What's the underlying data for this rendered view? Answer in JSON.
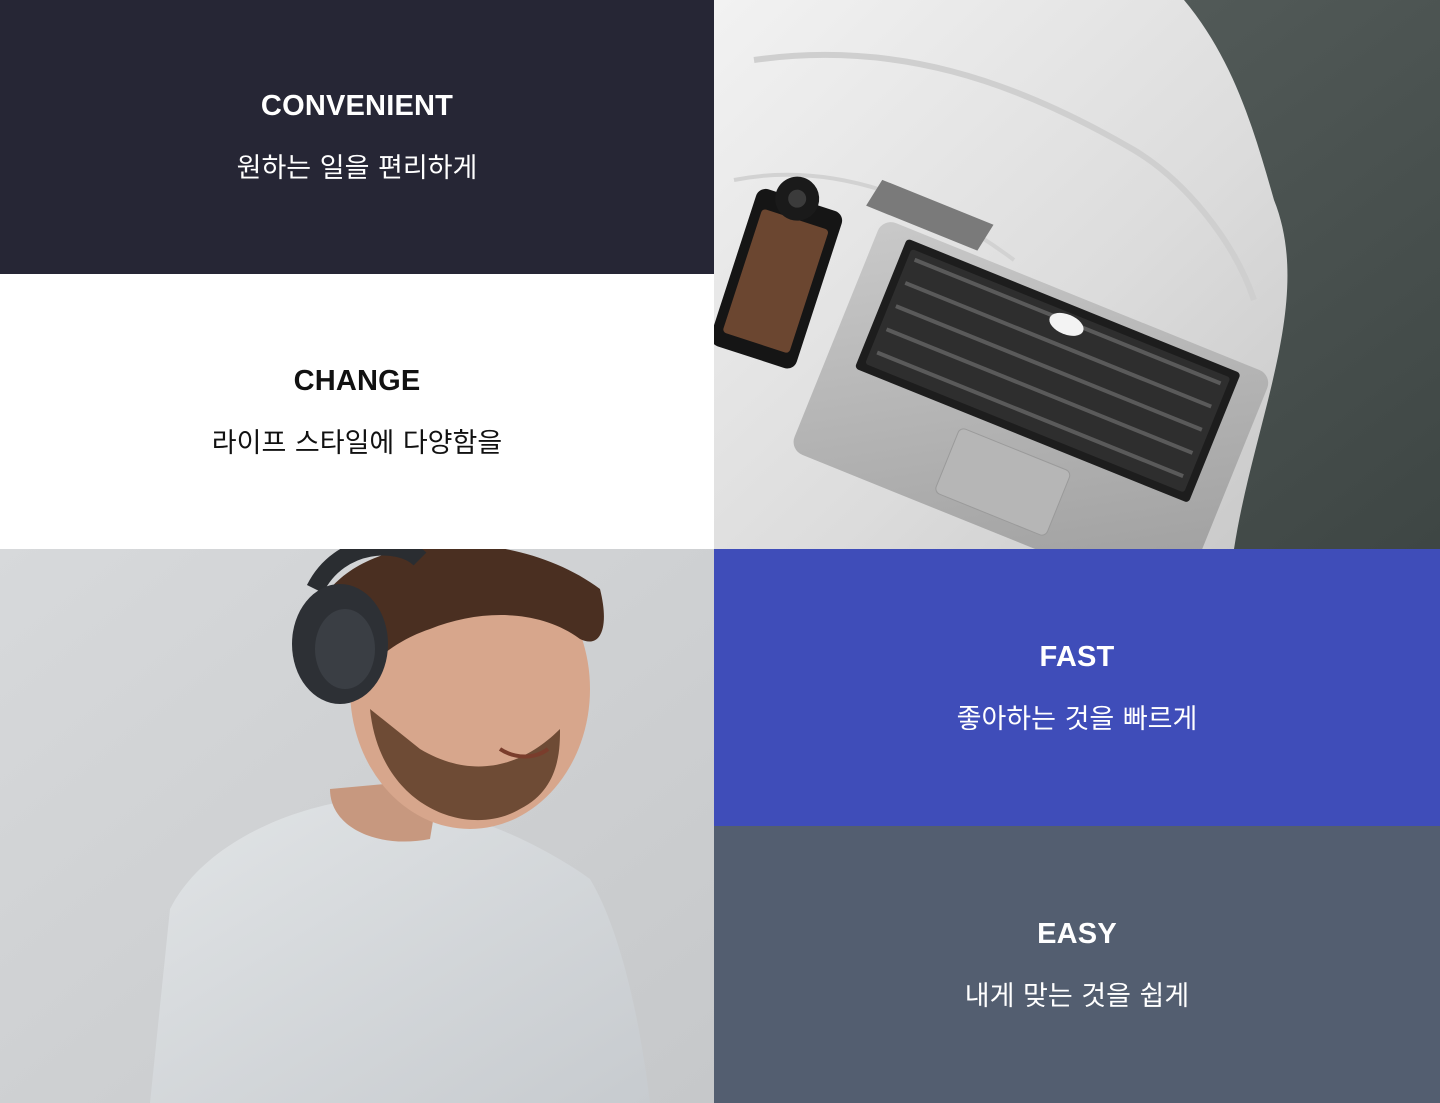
{
  "panels": {
    "convenient": {
      "title": "CONVENIENT",
      "subtitle": "원하는 일을 편리하게",
      "bg": "#262635",
      "fg": "#ffffff"
    },
    "change": {
      "title": "CHANGE",
      "subtitle": "라이프 스타일에 다양함을",
      "bg": "#ffffff",
      "fg": "#111111"
    },
    "fast": {
      "title": "FAST",
      "subtitle": "좋아하는 것을 빠르게",
      "bg": "#3f4db9",
      "fg": "#ffffff"
    },
    "easy": {
      "title": "EASY",
      "subtitle": "내게 맞는 것을 쉽게",
      "bg": "#535e70",
      "fg": "#ffffff"
    }
  },
  "photos": {
    "laptop": {
      "icon": "laptop-photo"
    },
    "person": {
      "icon": "person-with-headphones-photo"
    }
  }
}
